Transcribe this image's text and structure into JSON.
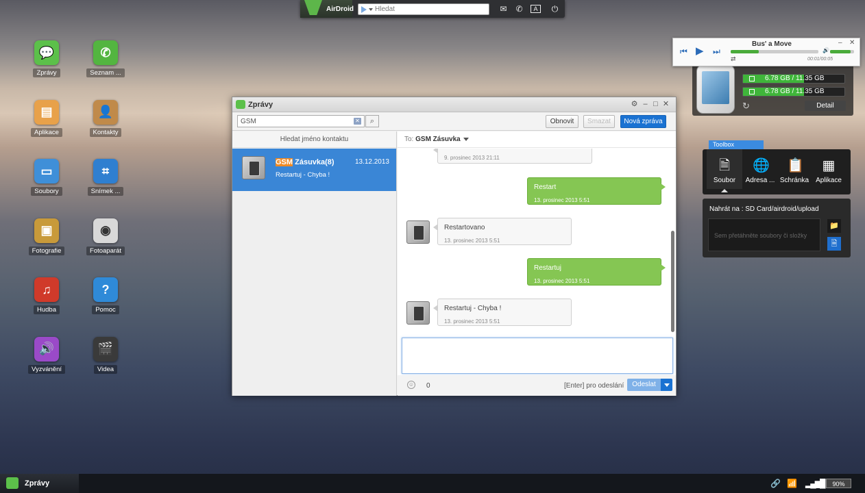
{
  "topbar": {
    "brand": "AirDroid",
    "search_placeholder": "Hledat"
  },
  "desktop_icons": [
    {
      "label": "Zprávy",
      "color": "#5cc04a"
    },
    {
      "label": "Seznam ...",
      "color": "#53b540"
    },
    {
      "label": "Aplikace",
      "color": "#e8a14a"
    },
    {
      "label": "Kontakty",
      "color": "#c08a4a"
    },
    {
      "label": "Soubory",
      "color": "#3f8fd8"
    },
    {
      "label": "Snímek ...",
      "color": "#2f7fd0"
    },
    {
      "label": "Fotografie",
      "color": "#c89a3a"
    },
    {
      "label": "Fotoaparát",
      "color": "#d8d8d8"
    },
    {
      "label": "Hudba",
      "color": "#d03a2a"
    },
    {
      "label": "Pomoc",
      "color": "#2f8ad8"
    },
    {
      "label": "Vyzvánění",
      "color": "#9a4ac8"
    },
    {
      "label": "Videa",
      "color": "#3a3a3a"
    }
  ],
  "window": {
    "title": "Zprávy",
    "search_value": "GSM",
    "buttons": {
      "refresh": "Obnovit",
      "delete": "Smazat",
      "new": "Nová zpráva"
    },
    "contact_list_header": "Hledat jméno kontaktu",
    "contact": {
      "name_highlight": "GSM",
      "name_rest": " Zásuvka(8)",
      "date": "13.12.2013",
      "snippet": "Restartuj - Chyba !"
    },
    "to_label": "To:",
    "to_name": "GSM Zásuvka",
    "messages": [
      {
        "dir": "in",
        "text": "",
        "ts": "9. prosinec 2013 21:11"
      },
      {
        "dir": "out",
        "text": "Restart",
        "ts": "13. prosinec 2013 5:51"
      },
      {
        "dir": "in",
        "text": "Restartovano",
        "ts": "13. prosinec 2013 5:51"
      },
      {
        "dir": "out",
        "text": "Restartuj",
        "ts": "13. prosinec 2013 5:51"
      },
      {
        "dir": "in",
        "text": "Restartuj - Chyba !",
        "ts": "13. prosinec 2013 5:51"
      }
    ],
    "char_count": "0",
    "enter_hint": "[Enter] pro odeslání",
    "send_label": "Odeslat"
  },
  "player": {
    "song": "Bus' a Move",
    "time": "00:01/00:05",
    "progress": 0.32,
    "volume": 0.85
  },
  "phone": {
    "storage1": "6.78 GB / 11.35 GB",
    "storage2": "6.78 GB / 11.35 GB",
    "storage1_used": 0.6,
    "storage2_used": 0.6,
    "detail": "Detail"
  },
  "toolbox": {
    "label": "Toolbox",
    "tools": [
      {
        "label": "Soubor"
      },
      {
        "label": "Adresa ..."
      },
      {
        "label": "Schránka"
      },
      {
        "label": "Aplikace"
      }
    ],
    "upload_label": "Nahrát na : SD Card/airdroid/upload",
    "drop_hint": "Sem přetáhněte soubory či složky"
  },
  "taskbar": {
    "app": "Zprávy",
    "battery": "90%"
  }
}
